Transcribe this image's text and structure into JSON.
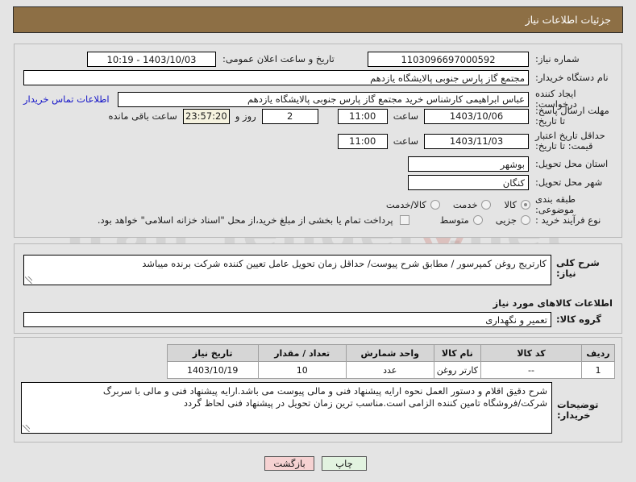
{
  "header": {
    "title": "جزئیات اطلاعات نیاز"
  },
  "watermark": {
    "text": "Iran Tender .net"
  },
  "fields": {
    "need_number_label": "شماره نیاز:",
    "need_number_value": "1103096697000592",
    "announce_label": "تاریخ و ساعت اعلان عمومی:",
    "announce_value": "1403/10/03 - 10:19",
    "buyer_org_label": "نام دستگاه خریدار:",
    "buyer_org_value": "مجتمع گاز پارس جنوبی  پالایشگاه یازدهم",
    "requester_label": "ایجاد کننده درخواست:",
    "requester_value": "عباس ابراهیمی کارشناس خرید مجتمع گاز پارس جنوبی  پالایشگاه یازدهم",
    "buyer_contact_link": "اطلاعات تماس خریدار",
    "deadline_label": "مهلت ارسال پاسخ: تا تاریخ:",
    "deadline_date": "1403/10/06",
    "deadline_hour_label": "ساعت",
    "deadline_hour": "11:00",
    "remaining_days": "2",
    "remaining_days_label": "روز و",
    "remaining_time": "23:57:20",
    "remaining_suffix": "ساعت باقی مانده",
    "price_validity_label": "حداقل تاریخ اعتبار قیمت: تا تاریخ:",
    "price_validity_date": "1403/11/03",
    "price_validity_hour_label": "ساعت",
    "price_validity_hour": "11:00",
    "province_label": "استان محل تحویل:",
    "province_value": "بوشهر",
    "city_label": "شهر محل تحویل:",
    "city_value": "کنگان",
    "subject_class_label": "طبقه بندی موضوعی:",
    "subject_options": [
      {
        "label": "کالا",
        "selected": true
      },
      {
        "label": "خدمت",
        "selected": false
      },
      {
        "label": "کالا/خدمت",
        "selected": false
      }
    ],
    "process_type_label": "نوع فرآیند خرید :",
    "process_options": [
      {
        "label": "جزیی",
        "selected": false
      },
      {
        "label": "متوسط",
        "selected": false
      }
    ],
    "treasury_checkbox_label": "پرداخت تمام یا بخشی از مبلغ خرید،از محل \"اسناد خزانه اسلامی\" خواهد بود.",
    "treasury_checked": false
  },
  "description": {
    "label": "شرح کلی نیاز:",
    "value": "کارتریج روغن کمپرسور / مطابق شرح پیوست/ حداقل زمان تحویل عامل تعیین کننده شرکت برنده میباشد"
  },
  "goods_section": {
    "heading": "اطلاعات کالاهای مورد نیاز",
    "group_label": "گروه کالا:",
    "group_value": "تعمیر و نگهداری"
  },
  "table": {
    "columns": [
      "ردیف",
      "کد کالا",
      "نام کالا",
      "واحد شمارش",
      "تعداد / مقدار",
      "تاریخ نیاز"
    ],
    "rows": [
      {
        "index": "1",
        "code": "--",
        "name": "کارتر روغن",
        "unit": "عدد",
        "quantity": "10",
        "need_date": "1403/10/19"
      }
    ]
  },
  "buyer_notes": {
    "label": "توضیحات خریدار:",
    "line1": "شرح دقیق اقلام و دستور العمل نحوه ارایه پیشنهاد فنی و مالی پیوست می باشد.ارایه پیشنهاد فنی و مالی با سربرگ",
    "line2": "شرکت/فروشگاه تامین کننده الزامی است.مناسب ترین زمان تحویل در پیشنهاد فنی لحاظ گردد"
  },
  "footer": {
    "back_label": "بازگشت",
    "print_label": "چاپ"
  }
}
